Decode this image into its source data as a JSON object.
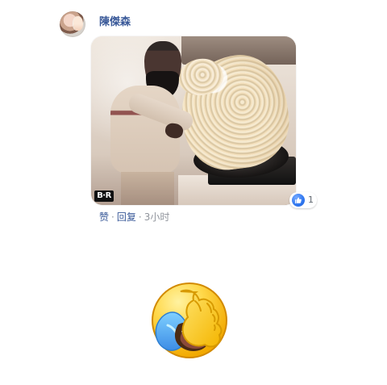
{
  "comment": {
    "author": "陳傑森",
    "photo": {
      "watermark": "B·R"
    },
    "reaction": {
      "icon": "thumbs-up-icon",
      "count": "1",
      "color": "#3b82f6"
    },
    "actions": {
      "like": "赞",
      "reply": "回复",
      "time": "3小时"
    }
  },
  "emoji": {
    "icon": "facepalm-laughing-emoji"
  }
}
